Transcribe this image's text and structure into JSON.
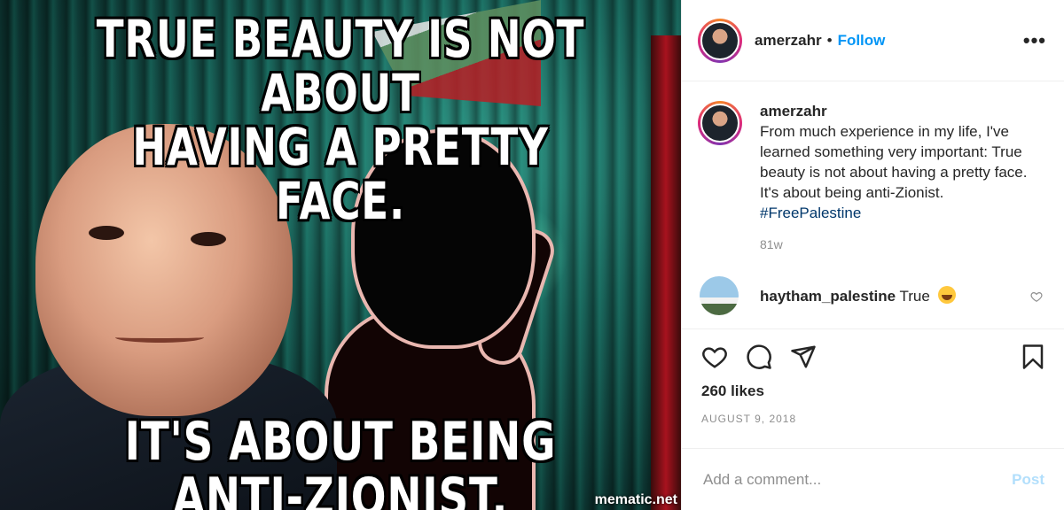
{
  "media": {
    "top_text": "TRUE BEAUTY IS NOT ABOUT HAVING A PRETTY FACE.",
    "top_line1": "TRUE BEAUTY IS NOT ABOUT",
    "top_line2": "HAVING A PRETTY FACE.",
    "bottom_text": "IT'S ABOUT BEING ANTI-ZIONIST.",
    "watermark": "mematic.net"
  },
  "header": {
    "username": "amerzahr",
    "separator": "•",
    "follow_label": "Follow",
    "more_icon": "more-horizontal-icon"
  },
  "caption": {
    "username": "amerzahr",
    "text": "From much experience in my life, I've learned something very important: True beauty is not about having a pretty face. It's about being anti-Zionist.",
    "hashtag": "#FreePalestine",
    "time_ago": "81w"
  },
  "comments": [
    {
      "username": "haytham_palestine",
      "text": "True",
      "emoji": "face-with-tears-of-joy"
    }
  ],
  "actions": {
    "icons": [
      "heart-icon",
      "comment-icon",
      "share-icon",
      "bookmark-icon"
    ],
    "likes": "260 likes",
    "date": "AUGUST 9, 2018"
  },
  "add_comment": {
    "placeholder": "Add a comment...",
    "post_label": "Post"
  },
  "colors": {
    "link": "#0095f6",
    "hashtag": "#00376b",
    "muted": "#8e8e8e",
    "post_disabled": "#b2dffc"
  }
}
